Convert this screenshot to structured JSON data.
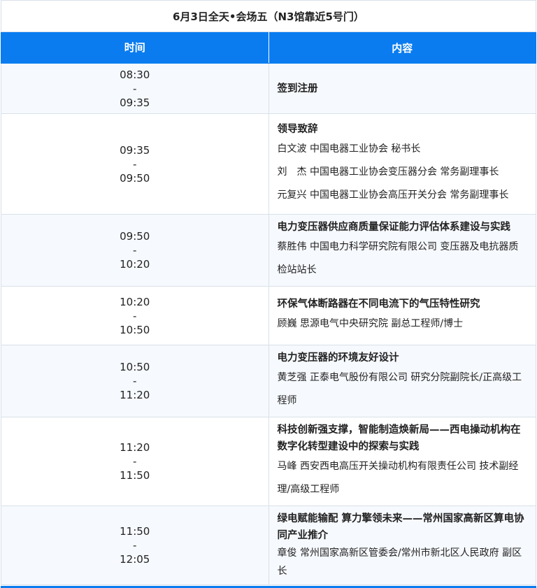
{
  "table": {
    "title": "6月3日全天•会场五（N3馆靠近5号门）",
    "header": {
      "time": "时间",
      "content": "内容"
    },
    "rows": [
      {
        "start": "08:30",
        "sep": "-",
        "end": "09:35",
        "topic": "签到注册",
        "speakers": []
      },
      {
        "start": "09:35",
        "sep": "-",
        "end": "09:50",
        "topic": "领导致辞",
        "speakers": [
          "白文波 中国电器工业协会 秘书长",
          "刘　杰 中国电器工业协会变压器分会 常务副理事长",
          "元复兴 中国电器工业协会高压开关分会 常务副理事长"
        ]
      },
      {
        "start": "09:50",
        "sep": "-",
        "end": "10:20",
        "topic": "电力变压器供应商质量保证能力评估体系建设与实践",
        "speakers": [
          "蔡胜伟 中国电力科学研究院有限公司 变压器及电抗器质检站站长"
        ]
      },
      {
        "start": "10:20",
        "sep": "-",
        "end": "10:50",
        "topic": "环保气体断路器在不同电流下的气压特性研究",
        "speakers": [
          "顾巍 思源电气中央研究院 副总工程师/博士"
        ]
      },
      {
        "start": "10:50",
        "sep": "-",
        "end": "11:20",
        "topic": "电力变压器的环境友好设计",
        "speakers": [
          "黄芝强 正泰电气股份有限公司 研究分院副院长/正高级工程师"
        ]
      },
      {
        "start": "11:20",
        "sep": "-",
        "end": "11:50",
        "topic": "科技创新强支撑，智能制造焕新局——西电操动机构在数字化转型建设中的探索与实践",
        "speakers": [
          "马峰 西安西电高压开关操动机构有限责任公司 技术副经理/高级工程师"
        ]
      },
      {
        "start": "11:50",
        "sep": "-",
        "end": "12:05",
        "topic": "绿电赋能输配 算力擎领未来——常州国家高新区算电协同产业推介",
        "speakers": [
          "章俊 常州国家高新区管委会/常州市新北区人民政府 副区长"
        ]
      }
    ]
  },
  "colors": {
    "header_bg": "#0a7cf0",
    "row_alt_bg": "#f6f9fd",
    "border": "#d9e1ea"
  }
}
